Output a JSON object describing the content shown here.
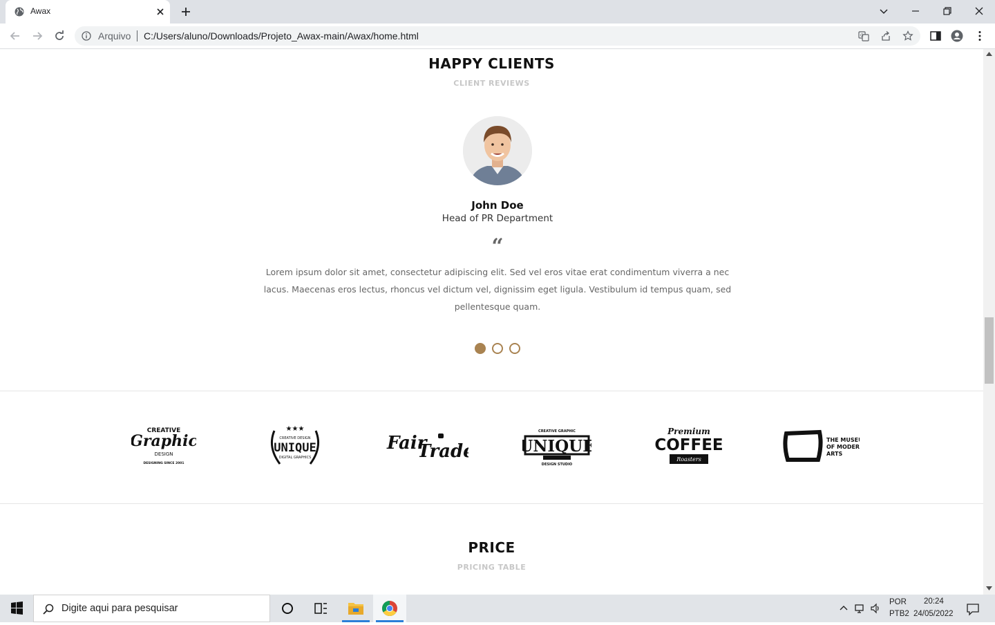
{
  "browser": {
    "tab_title": "Awax",
    "address_label": "Arquivo",
    "url": "C:/Users/aluno/Downloads/Projeto_Awax-main/Awax/home.html"
  },
  "clients": {
    "title": "HAPPY CLIENTS",
    "subtitle": "CLIENT REVIEWS",
    "name": "John Doe",
    "role": "Head of PR Department",
    "quote_mark": "“",
    "quote_lines": [
      "Lorem ipsum dolor sit amet, consectetur adipiscing elit. Sed vel eros vitae erat condimentum viverra a nec",
      "lacus. Maecenas eros lectus, rhoncus vel dictum vel, dignissim eget ligula. Vestibulum id tempus quam, sed",
      "pellentesque quam."
    ],
    "slider_dots": 3,
    "active_dot": 0,
    "accent_color": "#a98351"
  },
  "logos": {
    "graphic": {
      "line1": "CREATIVE",
      "main": "Graphic",
      "line2": "DESIGN",
      "line3": "DESIGNING SINCE 2001"
    },
    "unique_wreath": {
      "top": "CREATIVE DESIGN",
      "main": "UNIQUE",
      "bottom": "DIGITAL GRAPHICS"
    },
    "fairtrade": {
      "word1": "Fair",
      "word2": "Trade"
    },
    "unique_banner": {
      "top": "CREATIVE GRAPHIC",
      "main": "UNIQUE",
      "bottom": "DESIGN STUDIO"
    },
    "coffee": {
      "top": "Premium",
      "main": "COFFEE",
      "bottom": "Roasters"
    },
    "museum": {
      "line1": "THE MUSEUM",
      "line2": "OF MODERN",
      "line3": "ARTS"
    }
  },
  "price": {
    "title": "PRICE",
    "subtitle": "PRICING TABLE"
  },
  "taskbar": {
    "search_placeholder": "Digite aqui para pesquisar",
    "lang1": "POR",
    "lang2": "PTB2",
    "time": "20:24",
    "date": "24/05/2022"
  }
}
